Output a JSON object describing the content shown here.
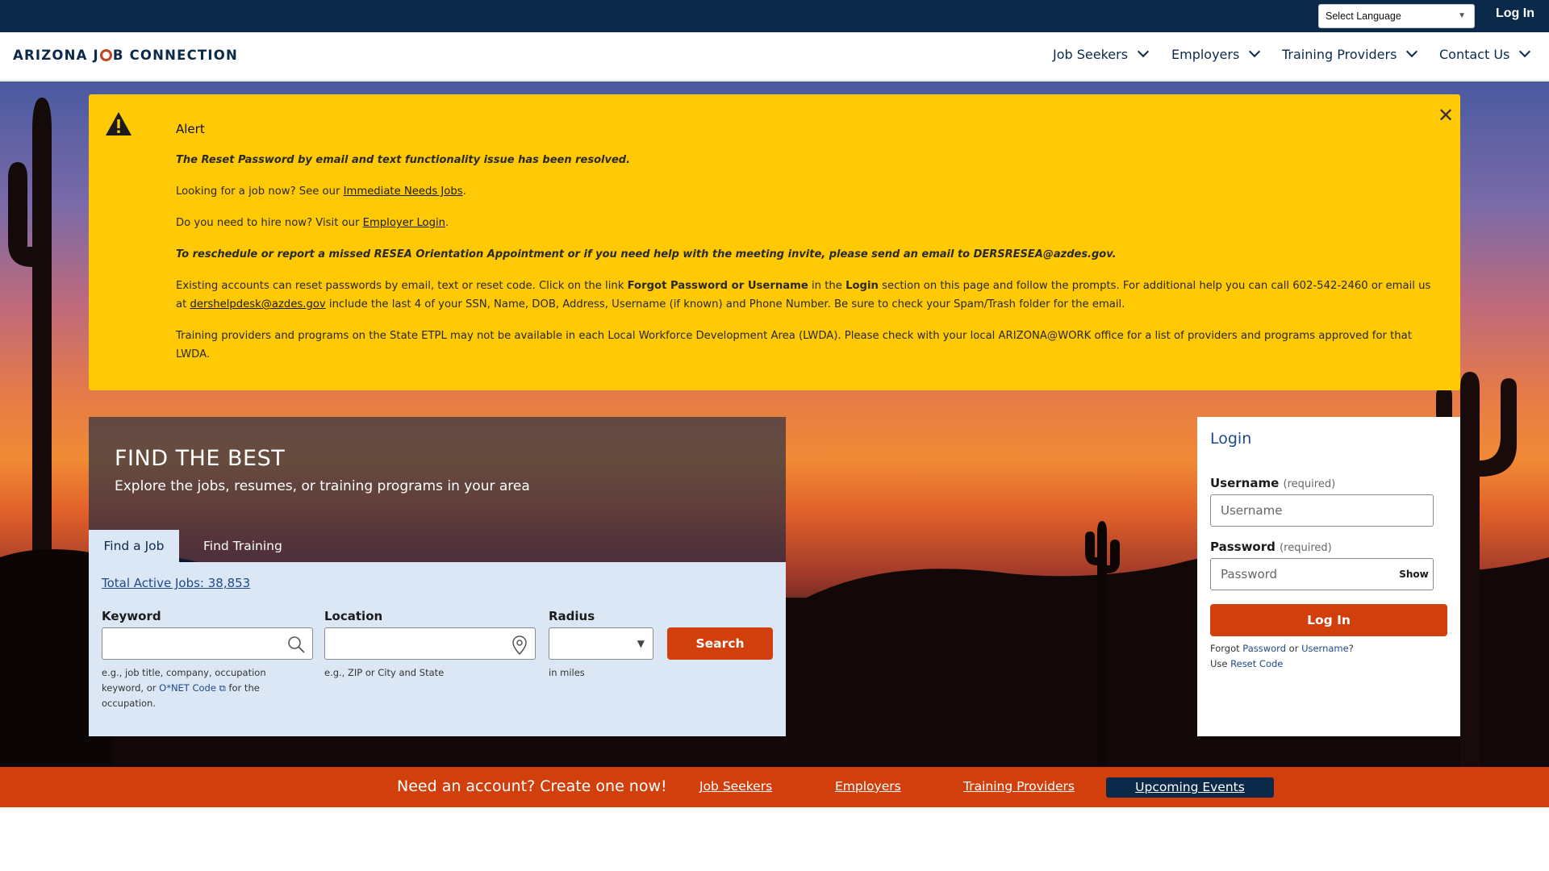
{
  "topbar": {
    "language_select": "Select Language",
    "login_link": "Log In"
  },
  "nav": {
    "logo_text_1": "ARIZONA J",
    "logo_text_2": "B CONNECTION",
    "items": [
      {
        "label": "Job Seekers"
      },
      {
        "label": "Employers"
      },
      {
        "label": "Training Providers"
      },
      {
        "label": "Contact Us"
      }
    ]
  },
  "alert": {
    "title": "Alert",
    "line1": "The Reset Password by email and text functionality issue has been resolved.",
    "line2_pre": "Looking for a job now? See our ",
    "line2_link": "Immediate Needs Jobs",
    "line2_post": ".",
    "line3_pre": "Do you need to hire now? Visit our ",
    "line3_link": "Employer Login",
    "line3_post": ".",
    "line4": "To reschedule or report a missed RESEA Orientation Appointment or if you need help with the meeting invite, please send an email to DERSRESEA@azdes.gov.",
    "line5_a": "Existing accounts can reset passwords by email, text or reset code. Click on the link ",
    "line5_b": "Forgot Password or Username",
    "line5_c": " in the ",
    "line5_d": "Login",
    "line5_e": " section on this page and follow the prompts. For additional help you can call 602-542-2460 or email us at ",
    "line5_link": "dershelpdesk@azdes.gov",
    "line5_f": " include the last 4 of your SSN, Name, DOB, Address, Username (if known) and Phone Number. Be sure to check your Spam/Trash folder for the email.",
    "line6": "Training providers and programs on the State ETPL may not be available in each Local Workforce Development Area (LWDA).  Please check with your local ARIZONA@WORK office for a list of providers and programs approved for that LWDA."
  },
  "find": {
    "heading": "FIND THE BEST",
    "subheading": "Explore the jobs, resumes, or training programs in your area",
    "tabs": [
      {
        "label": "Find a Job"
      },
      {
        "label": "Find Training"
      }
    ],
    "total_jobs": "Total Active Jobs: 38,853",
    "keyword_label": "Keyword",
    "keyword_help_1": "e.g., job title, company, occupation",
    "keyword_help_2_pre": "keyword, or ",
    "keyword_help_link": "O*NET Code",
    "keyword_help_2_post": " for the",
    "keyword_help_3": "occupation.",
    "location_label": "Location",
    "location_help": "e.g., ZIP or City and State",
    "radius_label": "Radius",
    "radius_help": "in miles",
    "search_button": "Search"
  },
  "login": {
    "title": "Login",
    "username_label": "Username",
    "username_req": "(required)",
    "username_placeholder": "Username",
    "password_label": "Password",
    "password_req": "(required)",
    "password_placeholder": "Password",
    "show_button": "Show",
    "login_button": "Log In",
    "forgot_pre": "Forgot ",
    "forgot_password": "Password",
    "forgot_or": " or ",
    "forgot_username": "Username",
    "forgot_post": "?",
    "use_pre": "Use ",
    "reset_code": "Reset Code"
  },
  "cta": {
    "message": "Need an account? Create one now!",
    "links": [
      {
        "label": "Job Seekers"
      },
      {
        "label": "Employers"
      },
      {
        "label": "Training Providers"
      },
      {
        "label": "Upcoming Events"
      }
    ]
  },
  "colors": {
    "navy": "#0b2a4a",
    "alert_yellow": "#ffc906",
    "action_orange": "#d13f0c",
    "panel_blue": "#dce7f5"
  }
}
